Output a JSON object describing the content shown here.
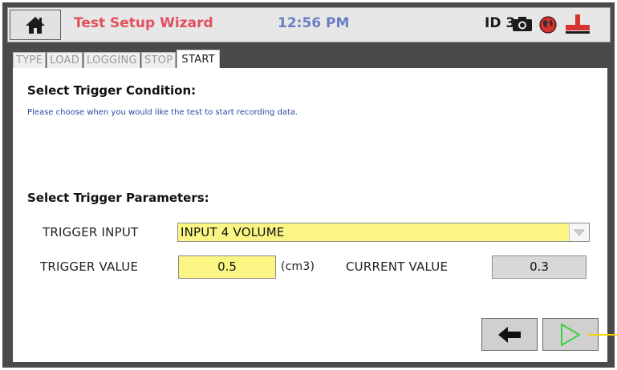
{
  "header": {
    "title": "Test Setup Wizard",
    "time": "12:56 PM",
    "device_id": "ID 3",
    "icons": [
      "home-icon",
      "camera-icon",
      "globe-icon",
      "plumbing-icon"
    ],
    "colors": {
      "title": "#e0505c",
      "time": "#6a7ec6"
    }
  },
  "tabs": [
    {
      "label": "TYPE",
      "active": false
    },
    {
      "label": "LOAD",
      "active": false
    },
    {
      "label": "LOGGING",
      "active": false
    },
    {
      "label": "STOP",
      "active": false
    },
    {
      "label": "START",
      "active": true
    }
  ],
  "trigger_condition": {
    "heading": "Select Trigger Condition:",
    "hint": "Please choose when you would like the test to start recording data."
  },
  "trigger_parameters": {
    "heading": "Select Trigger Parameters:",
    "input_label": "TRIGGER INPUT",
    "input_value": "INPUT 4 VOLUME",
    "value_label": "TRIGGER VALUE",
    "value": "0.5",
    "unit": "(cm3)",
    "current_label": "CURRENT VALUE",
    "current_value": "0.3"
  },
  "nav": {
    "back_icon": "arrow-left-icon",
    "next_icon": "play-icon",
    "colors": {
      "input_fill": "#fbf684",
      "next_arrow": "#3fcf3f"
    }
  }
}
